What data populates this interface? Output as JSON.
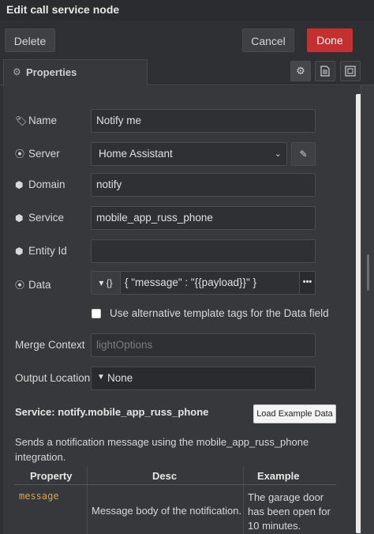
{
  "tray": {
    "title": "Edit call service node"
  },
  "buttons": {
    "delete": "Delete",
    "cancel": "Cancel",
    "done": "Done"
  },
  "tabs": {
    "properties": "Properties"
  },
  "form": {
    "name": {
      "label": "Name",
      "value": "Notify me"
    },
    "server": {
      "label": "Server",
      "value": "Home Assistant"
    },
    "domain": {
      "label": "Domain",
      "value": "notify"
    },
    "service": {
      "label": "Service",
      "value": "mobile_app_russ_phone"
    },
    "entity_id": {
      "label": "Entity Id",
      "value": ""
    },
    "data": {
      "label": "Data",
      "type": "{}",
      "value": "{ \"message\" : \"{{payload}}\" }"
    },
    "alt_tags": {
      "label": "Use alternative template tags for the Data field",
      "checked": false
    },
    "merge_context": {
      "label": "Merge Context",
      "placeholder": "lightOptions"
    },
    "output_location": {
      "label": "Output Location",
      "value": "None"
    }
  },
  "service_info": {
    "title": "Service: notify.mobile_app_russ_phone",
    "load_button": "Load Example Data",
    "description": "Sends a notification message using the mobile_app_russ_phone integration.",
    "table": {
      "headers": [
        "Property",
        "Desc",
        "Example"
      ],
      "rows": [
        {
          "property": "message",
          "desc": "Message body of the notification.",
          "example": "The garage door has been open for 10 minutes."
        }
      ]
    }
  },
  "colors": {
    "done": "#c42f2f",
    "property_mono": "#e3a43a",
    "background": "#36383c"
  }
}
